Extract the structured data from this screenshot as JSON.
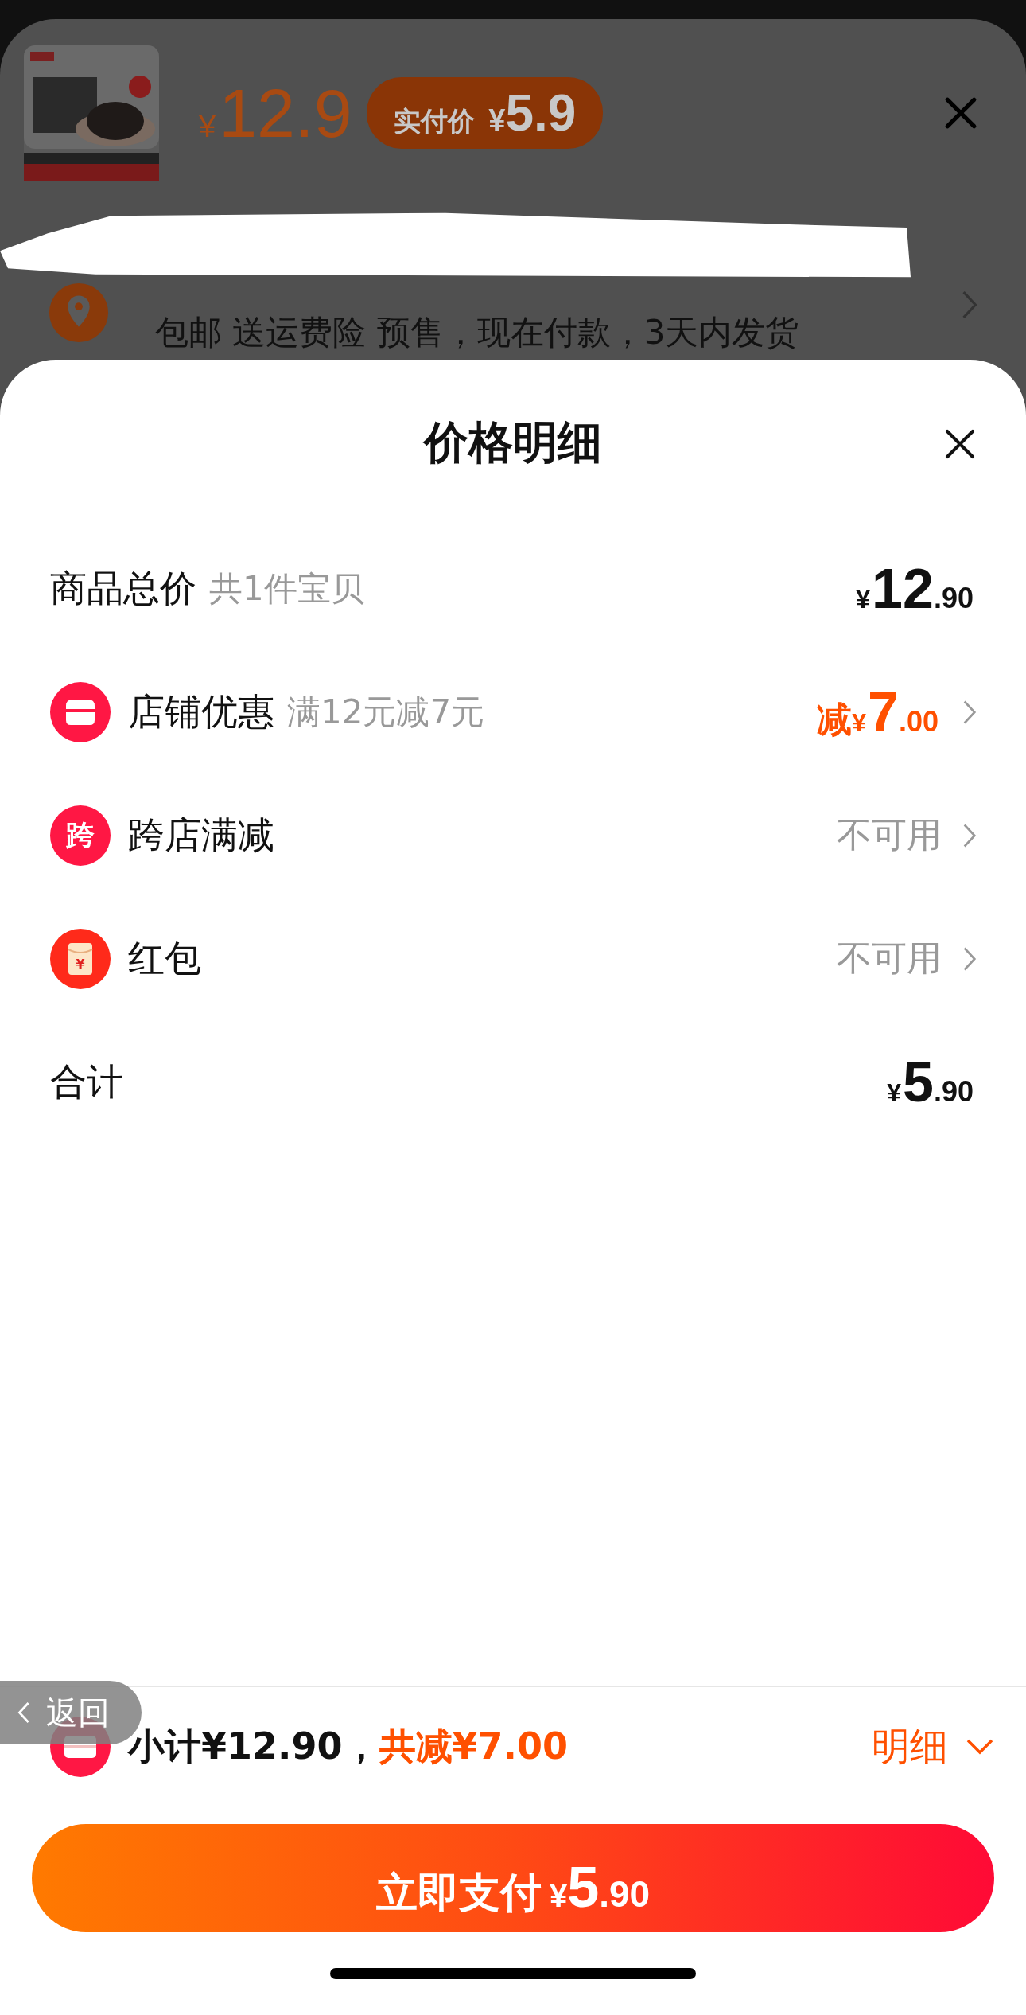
{
  "background_sheet": {
    "price_symbol": "¥",
    "price": "12.9",
    "badge_label": "实付价",
    "badge_symbol": "¥",
    "badge_price": "5.9",
    "shipping_text": "包邮 送运费险 预售，现在付款，3天内发货"
  },
  "sheet": {
    "title": "价格明细"
  },
  "rows": [
    {
      "kind": "plain",
      "label": "商品总价",
      "note": "共1件宝贝",
      "symbol": "¥",
      "integer": "12",
      "decimal": ".90"
    },
    {
      "kind": "discount",
      "label": "店铺优惠",
      "note": "满12元减7元",
      "prefix": "减",
      "symbol": "¥",
      "integer": "7",
      "decimal": ".00"
    },
    {
      "kind": "status",
      "icon_text": "跨",
      "label": "跨店满减",
      "status": "不可用"
    },
    {
      "kind": "status",
      "icon_text": "¥",
      "label": "红包",
      "status": "不可用"
    },
    {
      "kind": "plain",
      "label": "合计",
      "symbol": "¥",
      "integer": "5",
      "decimal": ".90"
    }
  ],
  "footer": {
    "subtotal": "小计¥12.90，",
    "reduction": "共减¥7.00",
    "details_link": "明细",
    "back_button": "返回",
    "pay_button": {
      "label": "立即支付",
      "symbol": "¥",
      "integer": "5",
      "decimal": ".90"
    }
  }
}
